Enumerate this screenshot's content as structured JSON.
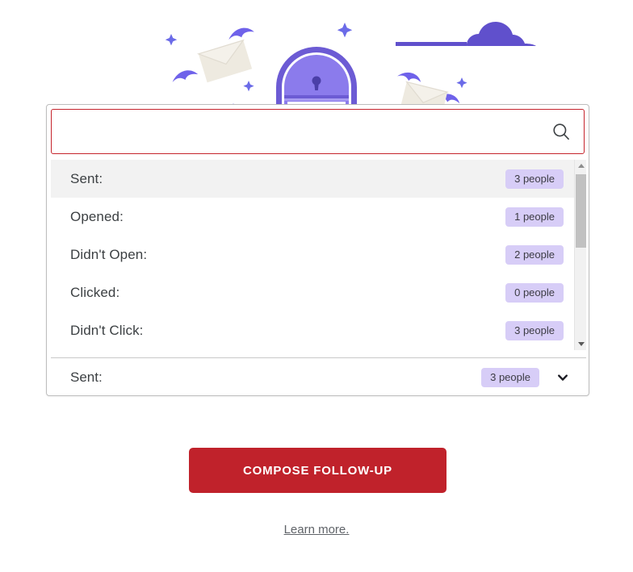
{
  "illustration": {
    "name": "mailbox-with-flying-envelopes",
    "colors": {
      "mailbox_outer": "#6c5bd4",
      "mailbox_inner": "#8b7bec",
      "keyhole": "#4b3fa8",
      "cloud": "#6050cc",
      "envelope_paper": "#eeeae0",
      "wing": "#6f62ea",
      "sparkle": "#6b6be8"
    }
  },
  "search": {
    "value": "",
    "placeholder": "",
    "icon": "search-icon",
    "border_color": "#c5242c"
  },
  "dropdown": {
    "items": [
      {
        "label": "Sent:",
        "badge": "3 people",
        "highlighted": true
      },
      {
        "label": "Opened:",
        "badge": "1 people",
        "highlighted": false
      },
      {
        "label": "Didn't Open:",
        "badge": "2 people",
        "highlighted": false
      },
      {
        "label": "Clicked:",
        "badge": "0 people",
        "highlighted": false
      },
      {
        "label": "Didn't Click:",
        "badge": "3 people",
        "highlighted": false
      }
    ],
    "badge_color": "#d7cdf7",
    "scrollbar": {
      "up_arrow": "scroll-up-arrow-icon",
      "down_arrow": "scroll-down-arrow-icon"
    }
  },
  "selected": {
    "label": "Sent:",
    "badge": "3 people",
    "chevron": "chevron-down-icon"
  },
  "cta": {
    "compose_label": "COMPOSE FOLLOW-UP",
    "color": "#c0222b"
  },
  "footer": {
    "learn_more_label": "Learn more."
  }
}
